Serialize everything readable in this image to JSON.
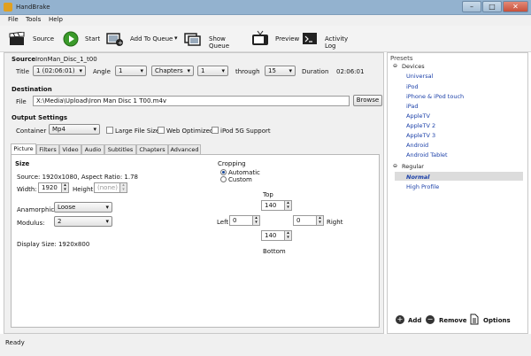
{
  "window": {
    "title": "HandBrake",
    "min": "–",
    "max": "□",
    "close": "✕"
  },
  "menu": [
    "File",
    "Tools",
    "Help"
  ],
  "toolbar": {
    "source": "Source",
    "start": "Start",
    "add_to_queue": "Add To Queue",
    "show_queue": "Show Queue",
    "preview": "Preview",
    "activity_log": "Activity Log"
  },
  "source": {
    "heading": "Source",
    "name": "IronMan_Disc_1_t00",
    "title_label": "Title",
    "title_value": "1 (02:06:01)",
    "angle_label": "Angle",
    "angle_value": "1",
    "range_mode": "Chapters",
    "range_start": "1",
    "through_label": "through",
    "range_end": "15",
    "duration_label": "Duration",
    "duration_value": "02:06:01"
  },
  "destination": {
    "heading": "Destination",
    "file_label": "File",
    "file_value": "X:\\Media\\Upload\\Iron Man Disc 1 T00.m4v",
    "browse": "Browse"
  },
  "output": {
    "heading": "Output Settings",
    "container_label": "Container",
    "container_value": "Mp4",
    "large_file": "Large File Size",
    "web_optimized": "Web Optimized",
    "ipod": "iPod 5G Support"
  },
  "tabs": [
    "Picture",
    "Filters",
    "Video",
    "Audio",
    "Subtitles",
    "Chapters",
    "Advanced"
  ],
  "picture": {
    "size_heading": "Size",
    "source_info": "Source:  1920x1080, Aspect Ratio: 1.78",
    "width_label": "Width:",
    "width_value": "1920",
    "height_label": "Height:",
    "height_value": "(none)",
    "anamorphic_label": "Anamorphic:",
    "anamorphic_value": "Loose",
    "modulus_label": "Modulus:",
    "modulus_value": "2",
    "display_size": "Display Size:   1920x800",
    "cropping_heading": "Cropping",
    "automatic": "Automatic",
    "custom": "Custom",
    "top_label": "Top",
    "top_value": "140",
    "left_label": "Left",
    "left_value": "0",
    "right_value": "0",
    "right_label": "Right",
    "bottom_value": "140",
    "bottom_label": "Bottom"
  },
  "presets": {
    "heading": "Presets",
    "devices_label": "Devices",
    "devices": [
      "Universal",
      "iPod",
      "iPhone & iPod touch",
      "iPad",
      "AppleTV",
      "AppleTV 2",
      "AppleTV 3",
      "Android",
      "Android Tablet"
    ],
    "regular_label": "Regular",
    "regular": [
      "Normal",
      "High Profile"
    ],
    "add": "Add",
    "remove": "Remove",
    "options": "Options"
  },
  "status": "Ready",
  "colors": {
    "accent": "#1a3fa8",
    "titlebar": "#93b2cf",
    "selected": "#dcdcdc"
  },
  "icons": {
    "source": "clapperboard-icon",
    "start": "play-icon",
    "queue": "add-queue-icon",
    "show_queue": "queue-icon",
    "preview": "tv-icon",
    "log": "terminal-icon"
  }
}
